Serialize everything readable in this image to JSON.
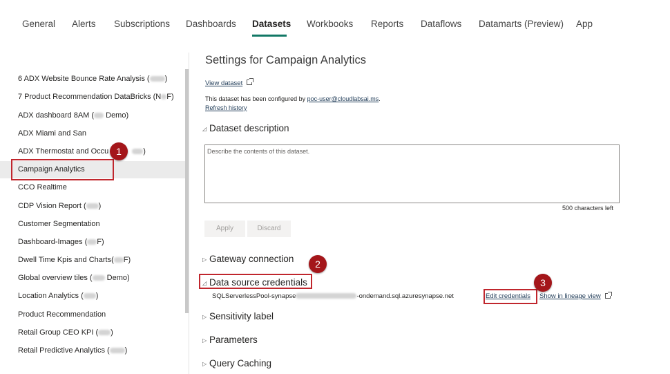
{
  "tabs": [
    {
      "label": "General"
    },
    {
      "label": "Alerts"
    },
    {
      "label": "Subscriptions"
    },
    {
      "label": "Dashboards"
    },
    {
      "label": "Datasets"
    },
    {
      "label": "Workbooks"
    },
    {
      "label": "Reports"
    },
    {
      "label": "Dataflows"
    },
    {
      "label": "Datamarts (Preview)"
    },
    {
      "label": "App"
    }
  ],
  "active_tab": "Datasets",
  "datasets": [
    {
      "label": "6 ADX Website Bounce Rate Analysis ("
    },
    {
      "label": "7 Product Recommendation DataBricks (N",
      "suffix": "F)"
    },
    {
      "label": "ADX dashboard 8AM (",
      "suffix": " Demo)"
    },
    {
      "label": "ADX Miami and San"
    },
    {
      "label": "ADX Thermostat and Occu",
      "suffix": ")"
    },
    {
      "label": "Campaign Analytics"
    },
    {
      "label": "CCO Realtime"
    },
    {
      "label": "CDP Vision Report (",
      "suffix": ")"
    },
    {
      "label": "Customer Segmentation"
    },
    {
      "label": "Dashboard-Images (",
      "suffix": "F)"
    },
    {
      "label": "Dwell Time Kpis and Charts(",
      "suffix": "F)"
    },
    {
      "label": "Global overview tiles (",
      "suffix": " Demo)"
    },
    {
      "label": "Location Analytics (",
      "suffix": ")"
    },
    {
      "label": "Product Recommendation"
    },
    {
      "label": "Retail Group CEO KPI (",
      "suffix": ")"
    },
    {
      "label": "Retail Predictive Analytics (",
      "suffix": ")"
    }
  ],
  "settings": {
    "title": "Settings for Campaign Analytics",
    "view_dataset": "View dataset",
    "configured_by_prefix": "This dataset has been configured by ",
    "configured_by_user": "poc-user@cloudlabsai.ms",
    "configured_by_suffix": ".",
    "refresh_history": "Refresh history",
    "dataset_description": "Dataset description",
    "description_placeholder": "Describe the contents of this dataset.",
    "chars_left": "500 characters left",
    "apply": "Apply",
    "discard": "Discard",
    "gateway_connection": "Gateway connection",
    "data_source_credentials": "Data source credentials",
    "source_prefix": "SQLServerlessPool-synapse",
    "source_suffix": "-ondemand.sql.azuresynapse.net",
    "edit_credentials": "Edit credentials",
    "show_lineage": "Show in lineage view",
    "sensitivity_label": "Sensitivity label",
    "parameters": "Parameters",
    "query_caching": "Query Caching"
  },
  "annotations": {
    "badge_1": "1",
    "badge_2": "2",
    "badge_3": "3",
    "color": "#c0262d"
  },
  "colors": {
    "tab_underline": "#117865",
    "selected_row": "#ebebeb"
  }
}
